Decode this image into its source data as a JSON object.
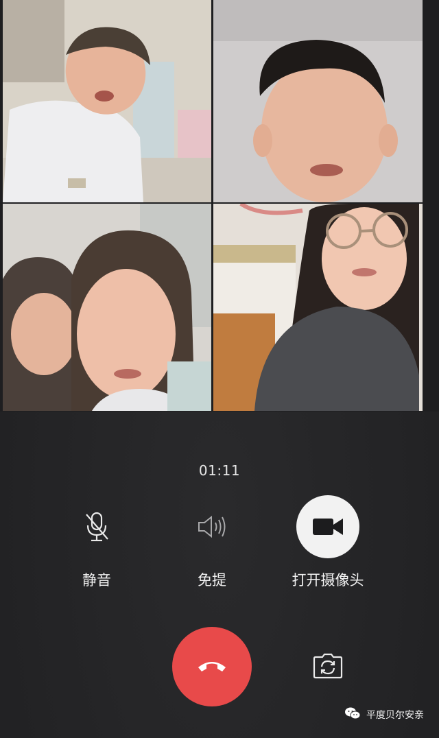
{
  "call": {
    "timer": "01:11"
  },
  "controls": {
    "mute_label": "静音",
    "speaker_label": "免提",
    "camera_label": "打开摄像头"
  },
  "icons": {
    "mute": "microphone-muted-icon",
    "speaker": "speaker-icon",
    "camera": "video-camera-icon",
    "hangup": "phone-hangup-icon",
    "switch_camera": "switch-camera-icon",
    "watermark": "wechat-icon"
  },
  "watermark": {
    "text": "平度贝尔安亲"
  },
  "colors": {
    "background": "#242426",
    "hangup": "#e84a4a",
    "camera_button": "#f2f2f2",
    "text": "#f2f2f2"
  }
}
